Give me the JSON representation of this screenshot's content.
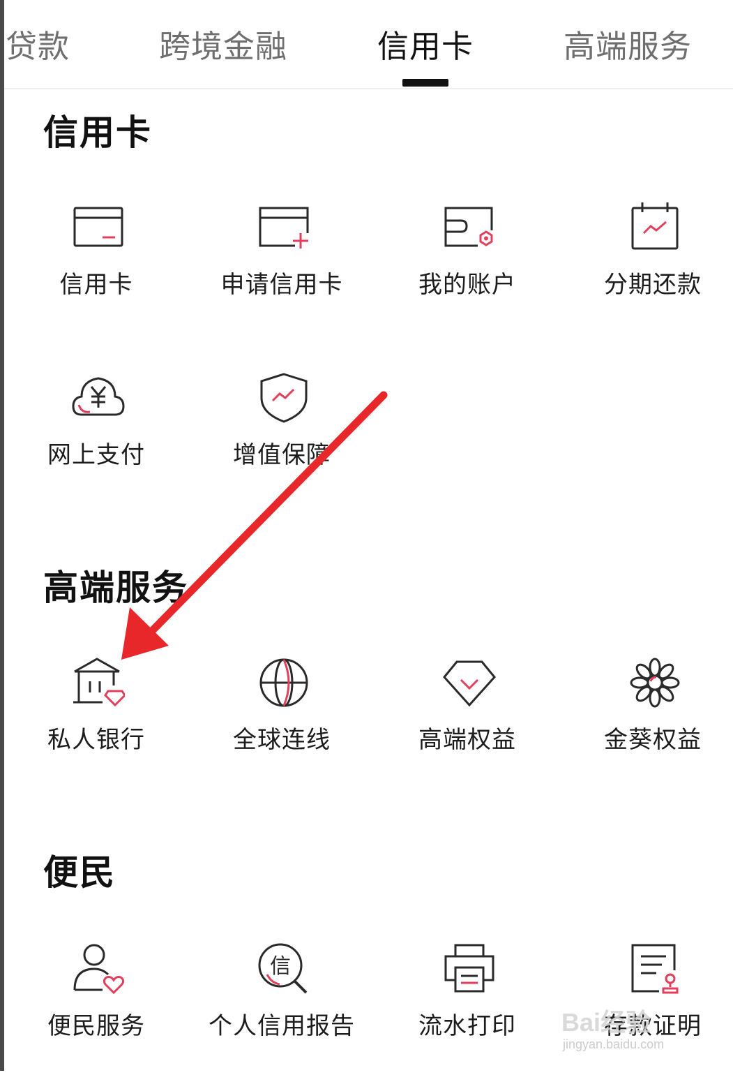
{
  "tabs": [
    {
      "label": "贷款"
    },
    {
      "label": "跨境金融"
    },
    {
      "label": "信用卡"
    },
    {
      "label": "高端服务"
    }
  ],
  "sections": {
    "credit": {
      "title": "信用卡",
      "items": [
        {
          "label": "信用卡",
          "icon": "credit-card-icon"
        },
        {
          "label": "申请信用卡",
          "icon": "apply-card-icon"
        },
        {
          "label": "我的账户",
          "icon": "wallet-account-icon"
        },
        {
          "label": "分期还款",
          "icon": "calendar-installment-icon"
        },
        {
          "label": "网上支付",
          "icon": "cloud-yuan-icon"
        },
        {
          "label": "增值保障",
          "icon": "shield-icon"
        }
      ]
    },
    "premium": {
      "title": "高端服务",
      "items": [
        {
          "label": "私人银行",
          "icon": "bank-diamond-icon"
        },
        {
          "label": "全球连线",
          "icon": "globe-icon"
        },
        {
          "label": "高端权益",
          "icon": "diamond-icon"
        },
        {
          "label": "金葵权益",
          "icon": "flower-icon"
        }
      ]
    },
    "convenience": {
      "title": "便民",
      "items": [
        {
          "label": "便民服务",
          "icon": "user-heart-icon"
        },
        {
          "label": "个人信用报告",
          "icon": "credit-report-search-icon"
        },
        {
          "label": "流水打印",
          "icon": "printer-icon"
        },
        {
          "label": "存款证明",
          "icon": "deposit-certificate-icon"
        }
      ]
    }
  },
  "watermark": {
    "brand": "Bai经验",
    "site": "jingyan.baidu.com"
  },
  "colors": {
    "accent": "#e0405c",
    "arrow": "#e8272a",
    "icon_stroke": "#2a2a2a"
  }
}
